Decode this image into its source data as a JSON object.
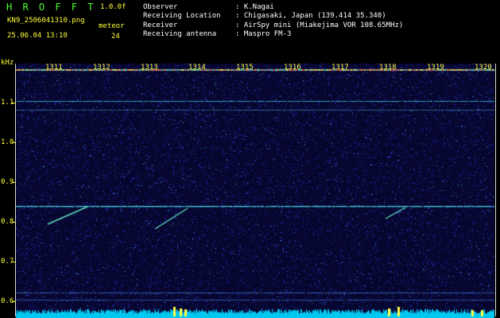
{
  "app": {
    "title": "H R O F F T",
    "version": "1.0.0f",
    "filename": "KN9_2506041310.png",
    "category_label": "meteor",
    "count": "24",
    "datetime": "25.06.04 13:10"
  },
  "info": {
    "labels": [
      "Observer",
      "Receiving Location",
      "Receiver",
      "Receiving antenna"
    ],
    "values": [
      ": K.Nagai",
      ": Chigasaki, Japan (139.414 35.340)",
      ": AirSpy mini (Miakejima VOR 108.65MHz)",
      ": Maspro FM-3"
    ]
  },
  "axis": {
    "unit": "kHz",
    "y_labels": [
      "1.1",
      "1.0",
      "0.9",
      "0.8",
      "0.7",
      "0.6"
    ],
    "minute_labels": [
      "1311",
      "1312",
      "1313",
      "1314",
      "1315",
      "1316",
      "1317",
      "1318",
      "1319",
      "1320"
    ]
  },
  "colors": {
    "background": "#05052a",
    "header_text": "#ffff3a",
    "title_text": "#4cff32",
    "carrier": "#48e0e0",
    "noise_floor": "#00c8f0"
  }
}
